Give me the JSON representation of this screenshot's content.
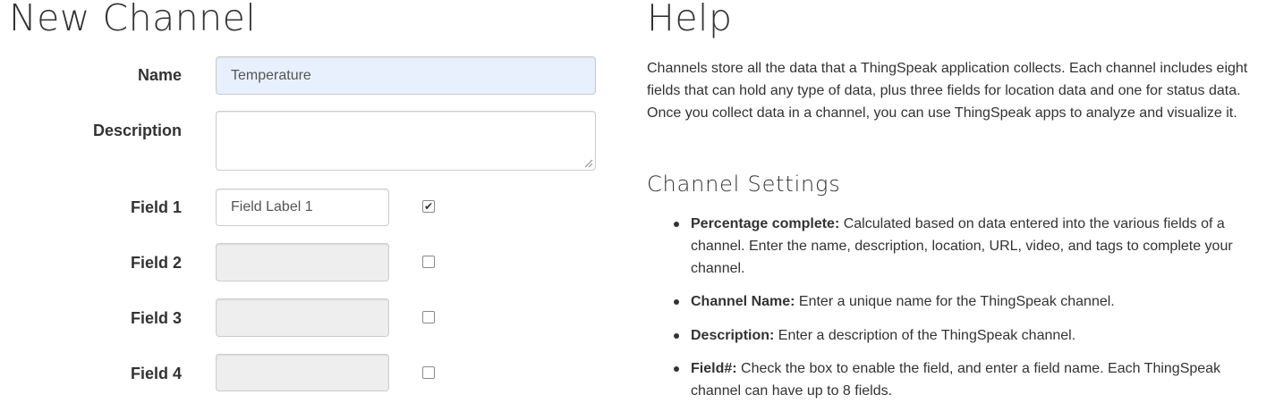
{
  "form": {
    "title": "New Channel",
    "name": {
      "label": "Name",
      "value": "Temperature"
    },
    "description": {
      "label": "Description",
      "value": ""
    },
    "fields": [
      {
        "label": "Field 1",
        "placeholder": "Field Label 1",
        "value": "",
        "checked": true,
        "check_glyph": "✔"
      },
      {
        "label": "Field 2",
        "placeholder": "",
        "value": "",
        "checked": false,
        "check_glyph": ""
      },
      {
        "label": "Field 3",
        "placeholder": "",
        "value": "",
        "checked": false,
        "check_glyph": ""
      },
      {
        "label": "Field 4",
        "placeholder": "",
        "value": "",
        "checked": false,
        "check_glyph": ""
      }
    ]
  },
  "help": {
    "title": "Help",
    "intro": "Channels store all the data that a ThingSpeak application collects. Each channel includes eight fields that can hold any type of data, plus three fields for location data and one for status data. Once you collect data in a channel, you can use ThingSpeak apps to analyze and visualize it.",
    "settings_title": "Channel Settings",
    "items": [
      {
        "term": "Percentage complete:",
        "text": " Calculated based on data entered into the various fields of a channel. Enter the name, description, location, URL, video, and tags to complete your channel."
      },
      {
        "term": "Channel Name:",
        "text": " Enter a unique name for the ThingSpeak channel."
      },
      {
        "term": "Description:",
        "text": " Enter a description of the ThingSpeak channel."
      },
      {
        "term": "Field#:",
        "text": " Check the box to enable the field, and enter a field name. Each ThingSpeak channel can have up to 8 fields."
      }
    ]
  },
  "colors": {
    "autofill_bg": "#e8f0fe",
    "disabled_bg": "#eeeeee",
    "border": "#cccccc",
    "text": "#333333"
  }
}
